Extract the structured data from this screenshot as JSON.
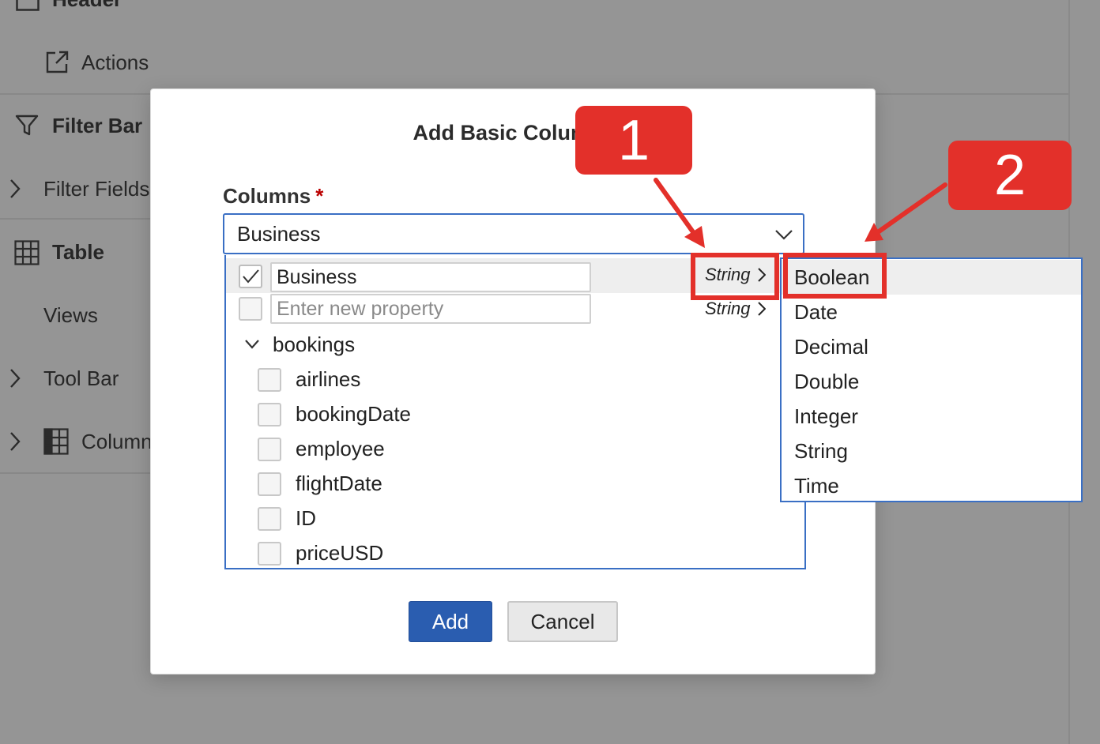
{
  "background": {
    "items": [
      {
        "label": "Header",
        "icon": "checkbox-square-icon"
      },
      {
        "label": "Actions",
        "icon": "external-link-icon"
      },
      {
        "label": "Filter Bar",
        "icon": "filter-icon"
      },
      {
        "label": "Filter Fields",
        "icon": "chevron-right-icon"
      },
      {
        "label": "Table",
        "icon": "table-grid-icon"
      },
      {
        "label": "Views"
      },
      {
        "label": "Tool Bar",
        "icon": "chevron-right-icon"
      },
      {
        "label": "Columns",
        "icon": "columns-icon"
      }
    ]
  },
  "dialog": {
    "title": "Add Basic Columns",
    "field_label": "Columns",
    "required_marker": "*",
    "selected_value": "Business",
    "rows": {
      "business": {
        "value": "Business",
        "type": "String",
        "checked": true
      },
      "new_property": {
        "placeholder": "Enter new property",
        "type": "String",
        "checked": false
      }
    },
    "group": {
      "label": "bookings",
      "items": [
        "airlines",
        "bookingDate",
        "employee",
        "flightDate",
        "ID",
        "priceUSD"
      ]
    },
    "buttons": {
      "add": "Add",
      "cancel": "Cancel"
    }
  },
  "type_menu": {
    "options": [
      "Boolean",
      "Date",
      "Decimal",
      "Double",
      "Integer",
      "String",
      "Time"
    ],
    "highlighted": "Boolean"
  },
  "annotations": {
    "callout_1": "1",
    "callout_2": "2",
    "color": "#e3302a"
  },
  "colors": {
    "accent_blue": "#2a5db0",
    "focus_border": "#3a6fc4",
    "overlay_gray": "#959595",
    "required_red": "#bb0000"
  }
}
